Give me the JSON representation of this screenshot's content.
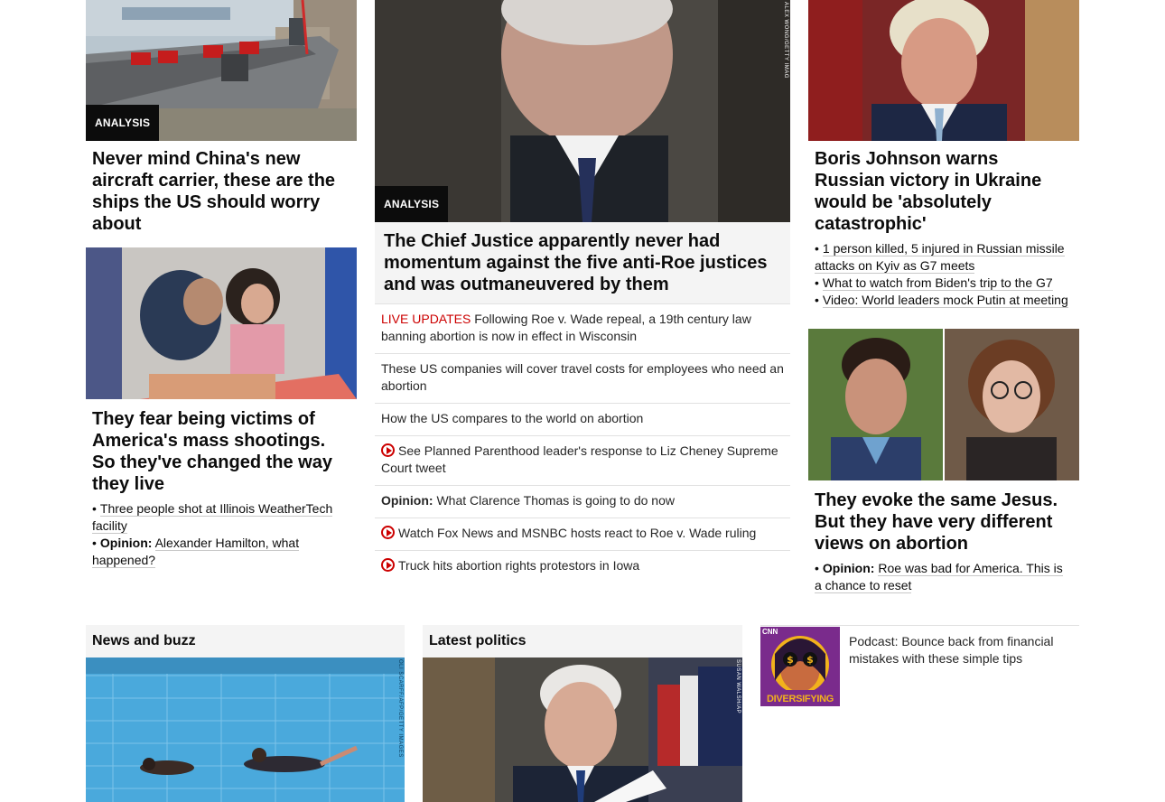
{
  "left": {
    "story1": {
      "label": "ANALYSIS",
      "headline": "Never mind China's new aircraft carrier, these are the ships the US should worry about"
    },
    "story2": {
      "headline": "They fear being victims of America's mass shootings. So they've changed the way they live",
      "links": [
        {
          "prefix": "",
          "text": "Three people shot at Illinois WeatherTech facility"
        },
        {
          "prefix": "Opinion:",
          "text": "Alexander Hamilton, what happened?"
        }
      ]
    }
  },
  "middle": {
    "label": "ANALYSIS",
    "photo_credit": "ALEX WONG/GETTY IMAG",
    "headline": "The Chief Justice apparently never had momentum against the five anti-Roe justices and was outmaneuvered by them",
    "items": [
      {
        "live": "LIVE UPDATES",
        "prefix": "",
        "text": "Following Roe v. Wade repeal, a 19th century law banning abortion is now in effect in Wisconsin",
        "video": false
      },
      {
        "live": "",
        "prefix": "",
        "text": "These US companies will cover travel costs for employees who need an abortion",
        "video": false
      },
      {
        "live": "",
        "prefix": "",
        "text": "How the US compares to the world on abortion",
        "video": false
      },
      {
        "live": "",
        "prefix": "",
        "text": "See Planned Parenthood leader's response to Liz Cheney Supreme Court tweet",
        "video": true
      },
      {
        "live": "",
        "prefix": "Opinion:",
        "text": "What Clarence Thomas is going to do now",
        "video": false
      },
      {
        "live": "",
        "prefix": "",
        "text": "Watch Fox News and MSNBC hosts react to Roe v. Wade ruling",
        "video": true
      },
      {
        "live": "",
        "prefix": "",
        "text": "Truck hits abortion rights protestors in Iowa",
        "video": true
      }
    ]
  },
  "right": {
    "story1": {
      "headline": "Boris Johnson warns Russian victory in Ukraine would be 'absolutely catastrophic'",
      "links": [
        {
          "prefix": "",
          "text": "1 person killed, 5 injured in Russian missile attacks on Kyiv as G7 meets"
        },
        {
          "prefix": "",
          "text": "What to watch from Biden's trip to the G7"
        },
        {
          "prefix": "",
          "text": "Video: World leaders mock Putin at meeting"
        }
      ]
    },
    "story2": {
      "headline": "They evoke the same Jesus. But they have very different views on abortion",
      "links": [
        {
          "prefix": "Opinion:",
          "text": "Roe was bad for America. This is a chance to reset"
        }
      ]
    }
  },
  "bottom": {
    "news_buzz": {
      "title": "News and buzz",
      "photo_credit": "OLI SCARFF/AFP/GETTY IMAGES"
    },
    "latest_politics": {
      "title": "Latest politics",
      "photo_credit": "SUSAN WALSH/AP"
    },
    "podcast": {
      "brand": "CNN",
      "show": "DIVERSIFYING",
      "text": "Podcast: Bounce back from financial mistakes with these simple tips"
    }
  }
}
